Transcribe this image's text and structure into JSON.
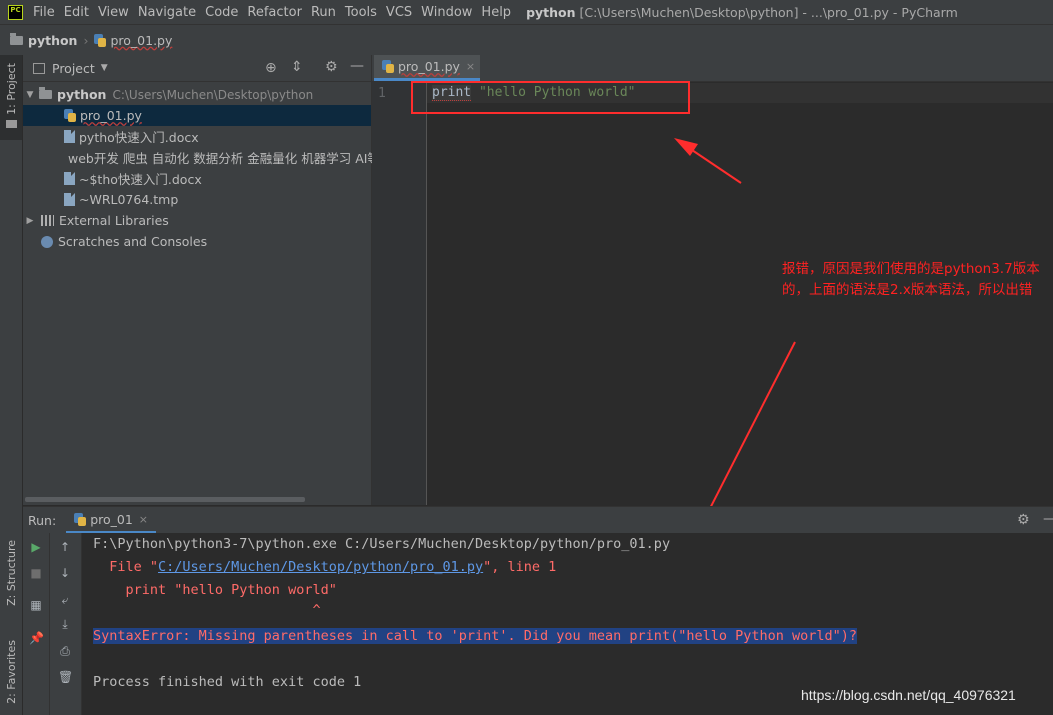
{
  "menubar": {
    "items": [
      "File",
      "Edit",
      "View",
      "Navigate",
      "Code",
      "Refactor",
      "Run",
      "Tools",
      "VCS",
      "Window",
      "Help"
    ],
    "title_project": "python",
    "title_rest": "[C:\\Users\\Muchen\\Desktop\\python] - ...\\pro_01.py - PyCharm"
  },
  "navbar": {
    "folder": "python",
    "file": "pro_01.py"
  },
  "left_strip": {
    "project": "1: Project",
    "structure": "Z: Structure",
    "favorites": "2: Favorites"
  },
  "project": {
    "header": "Project",
    "root_name": "python",
    "root_path": "C:\\Users\\Muchen\\Desktop\\python",
    "files": [
      "pro_01.py",
      "pytho快速入门.docx",
      "web开发 爬虫 自动化 数据分析 金融量化 机器学习 AI等",
      "~$tho快速入门.docx",
      "~WRL0764.tmp"
    ],
    "external_libraries": "External Libraries",
    "scratches": "Scratches and Consoles"
  },
  "editor": {
    "tab": "pro_01.py",
    "line_number": "1",
    "code_keyword": "print",
    "code_string": " \"hello Python world\""
  },
  "annotation": "报错，原因是我们使用的是python3.7版本的，上面的语法是2.x版本语法，所以出错",
  "run": {
    "label": "Run:",
    "tab": "pro_01",
    "console": {
      "cmd": "F:\\Python\\python3-7\\python.exe C:/Users/Muchen/Desktop/python/pro_01.py",
      "file_prefix": "  File \"",
      "file_link": "C:/Users/Muchen/Desktop/python/pro_01.py",
      "file_suffix": "\", line 1",
      "source": "    print \"hello Python world\"",
      "caret": "                           ^",
      "error": "SyntaxError: Missing parentheses in call to 'print'. Did you mean print(\"hello Python world\")?",
      "exit": "Process finished with exit code 1"
    }
  },
  "watermark": "https://blog.csdn.net/qq_40976321",
  "colors": {
    "accent": "#4a88c7",
    "annotation_red": "#ff2d2d",
    "error_text": "#ff6b68",
    "string": "#6a8759"
  }
}
